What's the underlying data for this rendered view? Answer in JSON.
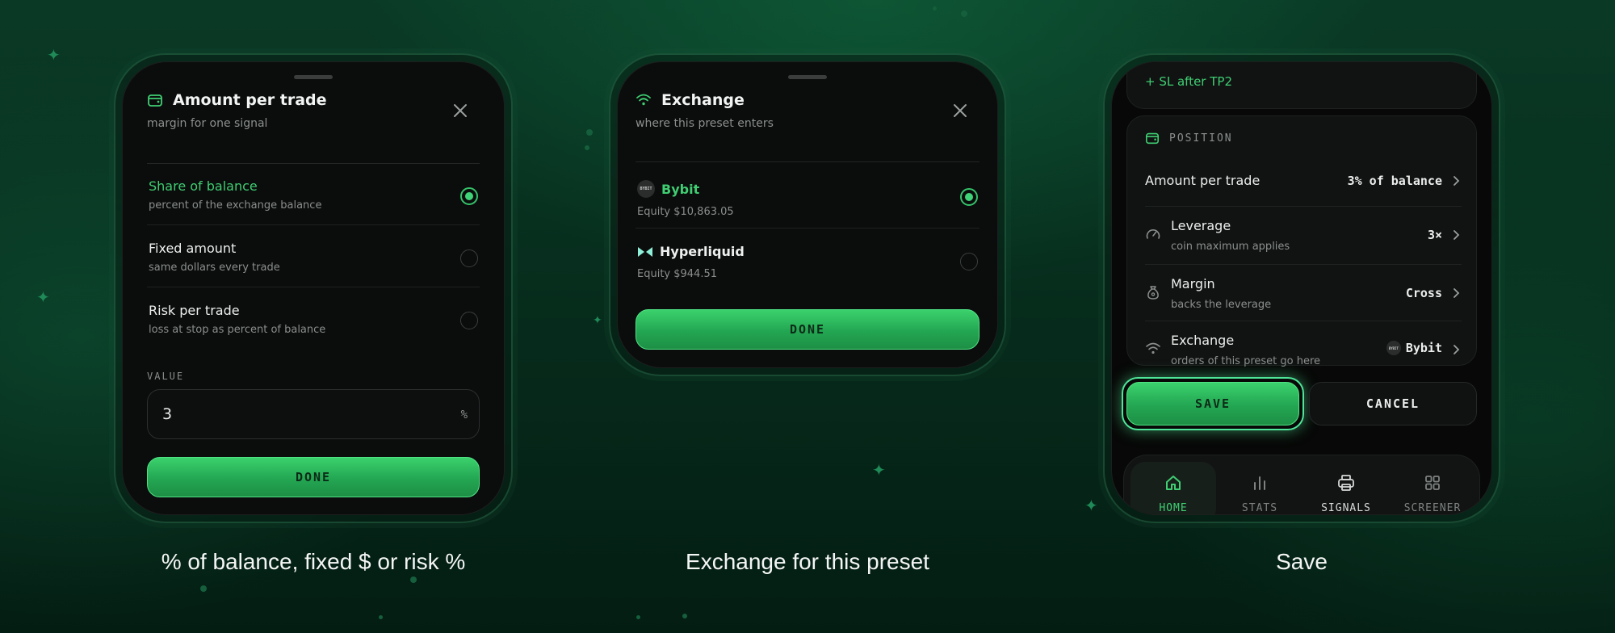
{
  "phone1": {
    "title": "Amount per trade",
    "subtitle": "margin for one signal",
    "options": [
      {
        "title": "Share of balance",
        "subtitle": "percent of the exchange balance",
        "selected": true
      },
      {
        "title": "Fixed amount",
        "subtitle": "same dollars every trade",
        "selected": false
      },
      {
        "title": "Risk per trade",
        "subtitle": "loss at stop as percent of balance",
        "selected": false
      }
    ],
    "value_label": "VALUE",
    "value": "3",
    "value_unit": "%",
    "done_label": "DONE",
    "caption": "% of balance, fixed $ or risk %"
  },
  "phone2": {
    "title": "Exchange",
    "subtitle": "where this preset enters",
    "options": [
      {
        "name": "Bybit",
        "logo": "BYBIT",
        "equity": "Equity $10,863.05",
        "selected": true
      },
      {
        "name": "Hyperliquid",
        "logo": "",
        "equity": "Equity $944.51",
        "selected": false
      }
    ],
    "done_label": "DONE",
    "caption": "Exchange for this preset"
  },
  "phone3": {
    "top_note": "+ SL after TP2",
    "section_label": "POSITION",
    "rows": [
      {
        "title": "Amount per trade",
        "subtitle": "",
        "value": "3% of balance",
        "icon": "none"
      },
      {
        "title": "Leverage",
        "subtitle": "coin maximum applies",
        "value": "3×",
        "icon": "gauge-icon"
      },
      {
        "title": "Margin",
        "subtitle": "backs the leverage",
        "value": "Cross",
        "icon": "money-bag-icon"
      },
      {
        "title": "Exchange",
        "subtitle": "orders of this preset go here",
        "value": "Bybit",
        "value_logo": "BYBIT",
        "icon": "wifi-icon"
      }
    ],
    "save_label": "SAVE",
    "cancel_label": "CANCEL",
    "nav": [
      {
        "label": "HOME",
        "icon": "home-icon",
        "active": true
      },
      {
        "label": "STATS",
        "icon": "bar-chart-icon",
        "active": false
      },
      {
        "label": "SIGNALS",
        "icon": "printer-icon",
        "active": false
      },
      {
        "label": "SCREENER",
        "icon": "grid-icon",
        "active": false
      }
    ],
    "caption": "Save"
  },
  "colors": {
    "accent": "#3fce72",
    "background": "#062a1b",
    "sheet": "#0b0c0c"
  }
}
